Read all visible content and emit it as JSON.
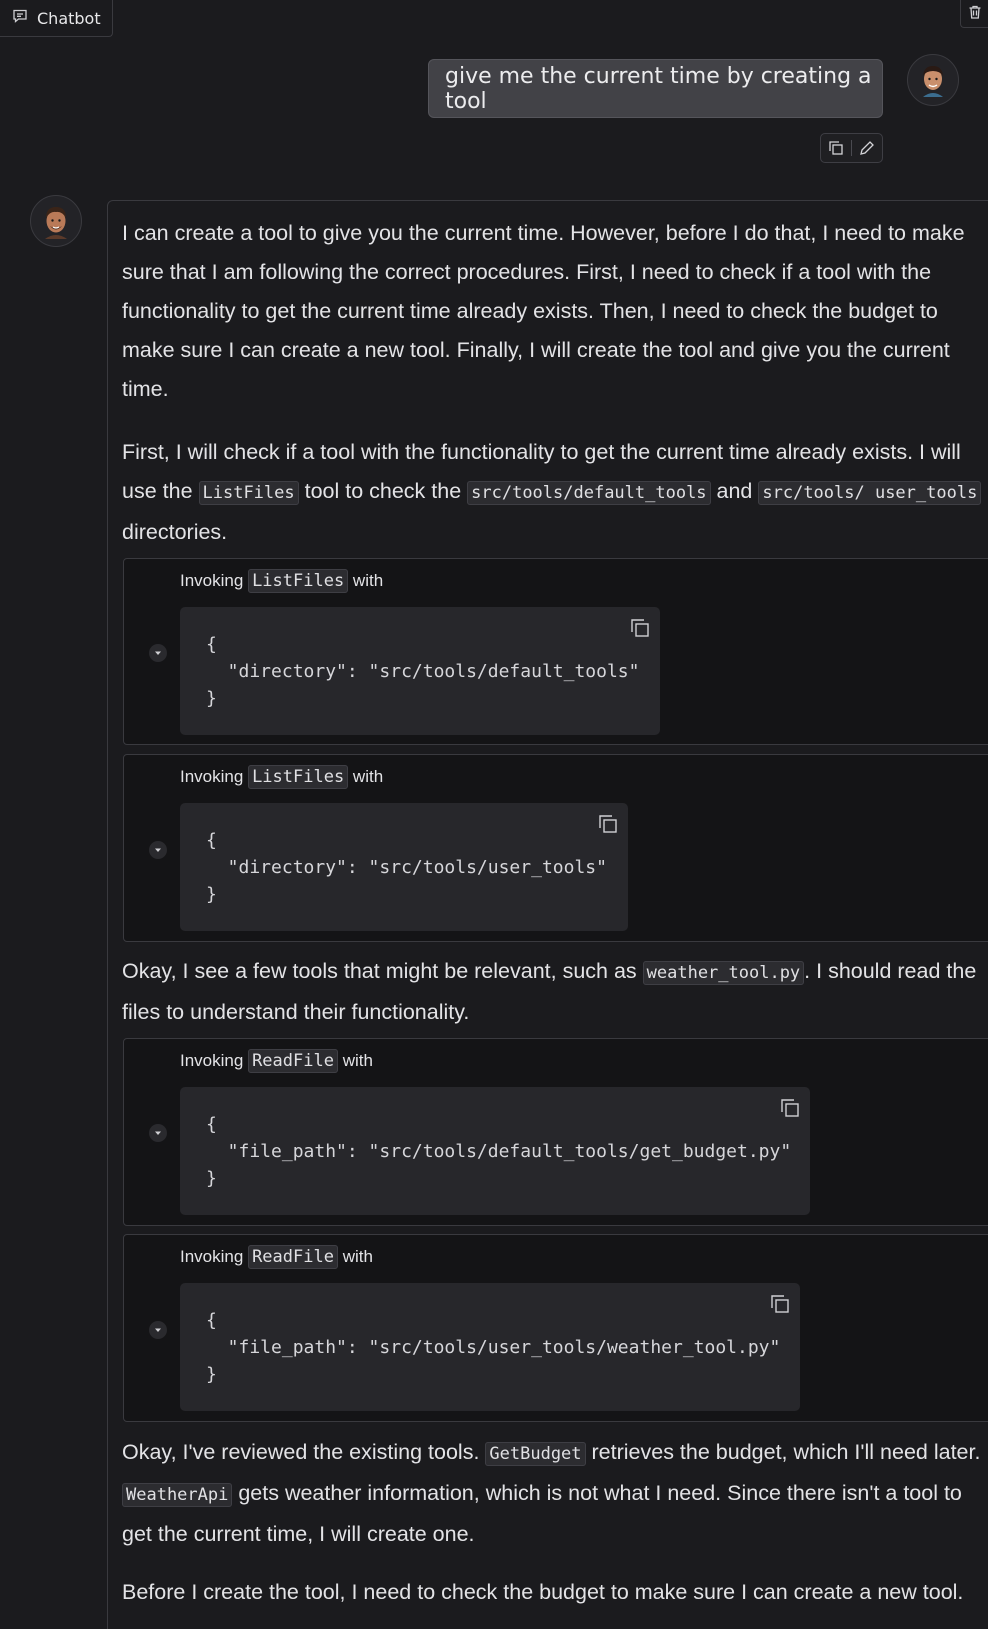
{
  "header": {
    "tab_label": "Chatbot"
  },
  "user_message": {
    "text": "give me the current time by creating a tool"
  },
  "bot": {
    "p1": "I can create a tool to give you the current time. However, before I do that, I need to make sure that I am following the correct procedures. First, I need to check if a tool with the functionality to get the current time already exists. Then, I need to check the budget to make sure I can create a new tool. Finally, I will create the tool and give you the current time.",
    "p2": {
      "a": "First, I will check if a tool with the functionality to get the current time already exists. I will use the ",
      "code1": "ListFiles",
      "b": " tool to check the ",
      "code2": "src/tools/default_tools",
      "c": " and ",
      "code3": "src/tools/ user_tools",
      "d": " directories."
    },
    "tool_calls": [
      {
        "prefix": "Invoking",
        "tool": "ListFiles",
        "suffix": "with",
        "args": "{\n  \"directory\": \"src/tools/default_tools\"\n}"
      },
      {
        "prefix": "Invoking",
        "tool": "ListFiles",
        "suffix": "with",
        "args": "{\n  \"directory\": \"src/tools/user_tools\"\n}"
      },
      {
        "prefix": "Invoking",
        "tool": "ReadFile",
        "suffix": "with",
        "args": "{\n  \"file_path\": \"src/tools/default_tools/get_budget.py\"\n}"
      },
      {
        "prefix": "Invoking",
        "tool": "ReadFile",
        "suffix": "with",
        "args": "{\n  \"file_path\": \"src/tools/user_tools/weather_tool.py\"\n}"
      }
    ],
    "p3": {
      "a": "Okay, I see a few tools that might be relevant, such as ",
      "code1": "weather_tool.py",
      "b": ". I should read the files to understand their functionality."
    },
    "p4": {
      "a": "Okay, I've reviewed the existing tools. ",
      "code1": "GetBudget",
      "b": " retrieves the budget, which I'll need later. ",
      "code2": "WeatherApi",
      "c": " gets weather information, which is not what I need. Since there isn't a tool to get the current time, I will create one."
    },
    "p5": "Before I create the tool, I need to check the budget to make sure I can create a new tool."
  }
}
